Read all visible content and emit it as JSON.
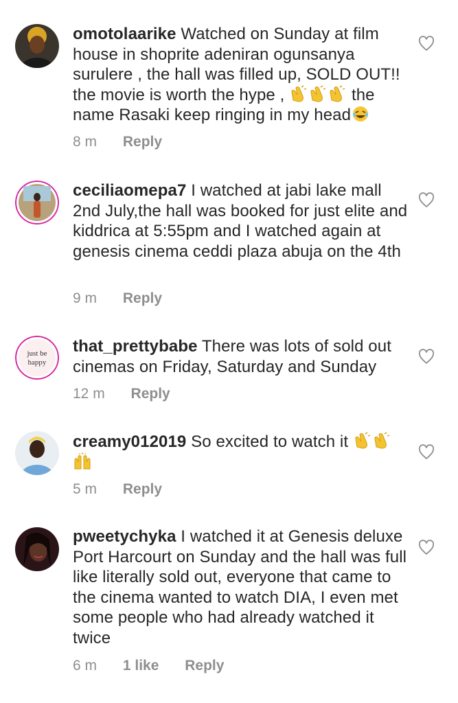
{
  "comments": [
    {
      "username": "omotolaarike",
      "text": "Watched on Sunday at film house in shoprite adeniran ogunsanya surulere , the hall was filled up, SOLD OUT!! the movie is worth the hype ,",
      "text_tail": "the name Rasaki keep ringing in my head",
      "emojis": [
        "clapping-hands",
        "clapping-hands",
        "clapping-hands",
        "laughing-face"
      ],
      "time": "8 m",
      "reply_label": "Reply"
    },
    {
      "username": "ceciliaomepa7",
      "text": "I watched at jabi lake mall 2nd July,the hall was booked for just elite and kiddrica at 5:55pm and I watched again at genesis cinema ceddi plaza abuja on the 4th",
      "time": "9 m",
      "reply_label": "Reply"
    },
    {
      "username": "that_prettybabe",
      "text": "There was lots of sold out cinemas on Friday, Saturday and Sunday",
      "avatar_text_1": "just be",
      "avatar_text_2": "happy",
      "time": "12 m",
      "reply_label": "Reply"
    },
    {
      "username": "creamy012019",
      "text": "So excited to watch it",
      "emojis": [
        "clapping-hands",
        "clapping-hands",
        "raising-hands"
      ],
      "time": "5 m",
      "reply_label": "Reply"
    },
    {
      "username": "pweetychyka",
      "text": "I watched it at Genesis deluxe Port Harcourt on Sunday and the hall was full like literally sold out, everyone that came to the cinema wanted to watch DIA, I even met some people who had already watched it twice",
      "time": "6 m",
      "likes": "1 like",
      "reply_label": "Reply"
    }
  ],
  "colors": {
    "text": "#262626",
    "meta": "#8e8e8e",
    "heart_outline": "#8e8e8e",
    "story_ring": "#d6249f"
  },
  "icons": {
    "like": "heart-outline-icon"
  }
}
